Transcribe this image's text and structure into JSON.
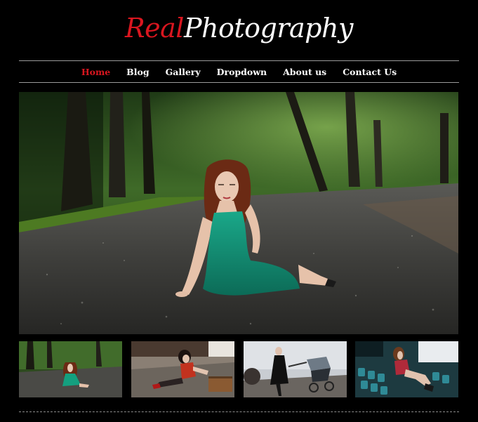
{
  "logo": {
    "part1": "Real",
    "part2": "Photography"
  },
  "nav": {
    "items": [
      {
        "label": "Home",
        "active": true
      },
      {
        "label": "Blog",
        "active": false
      },
      {
        "label": "Gallery",
        "active": false
      },
      {
        "label": "Dropdown",
        "active": false
      },
      {
        "label": "About us",
        "active": false
      },
      {
        "label": "Contact Us",
        "active": false
      }
    ]
  },
  "colors": {
    "background": "#000000",
    "accent": "#d9161f",
    "text": "#ffffff",
    "divider": "#9a9a9a"
  }
}
